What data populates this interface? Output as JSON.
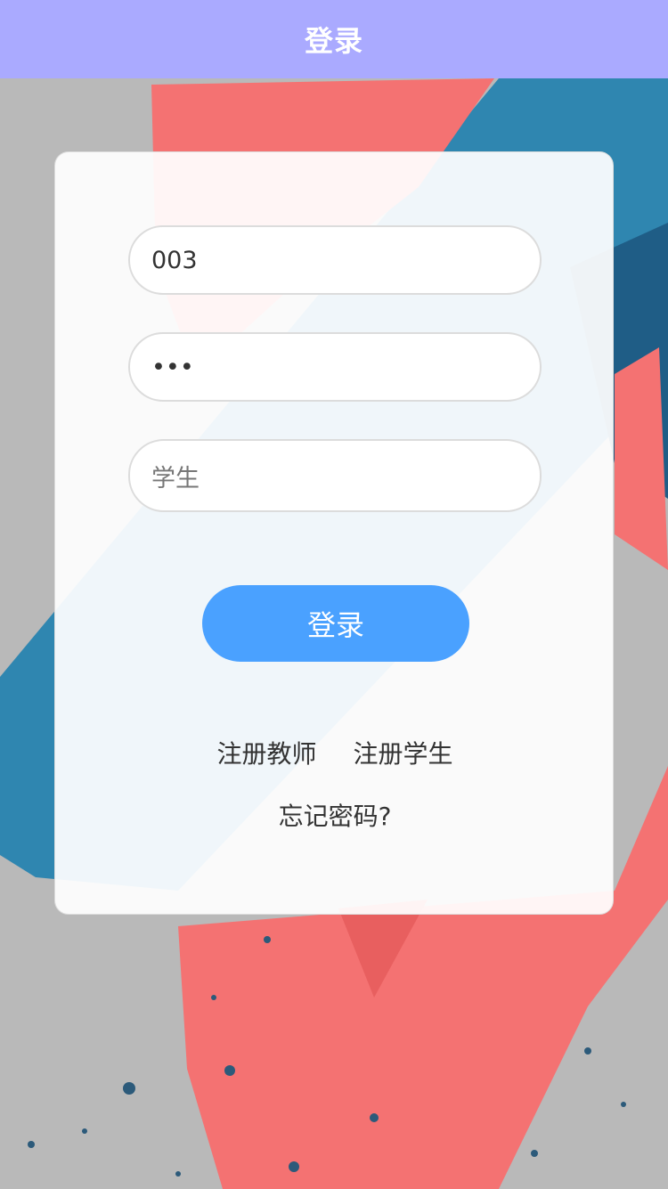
{
  "header": {
    "title": "登录"
  },
  "form": {
    "username_value": "003",
    "password_value": "•••",
    "role_value": "学生",
    "login_button": "登录"
  },
  "links": {
    "register_teacher": "注册教师",
    "register_student": "注册学生",
    "forgot_password": "忘记密码?"
  },
  "colors": {
    "navbar": "#aaaaff",
    "button": "#4aa1ff",
    "background": "#b9b9b9",
    "paint_red": "#f47272",
    "paint_blue": "#2f86b0"
  }
}
